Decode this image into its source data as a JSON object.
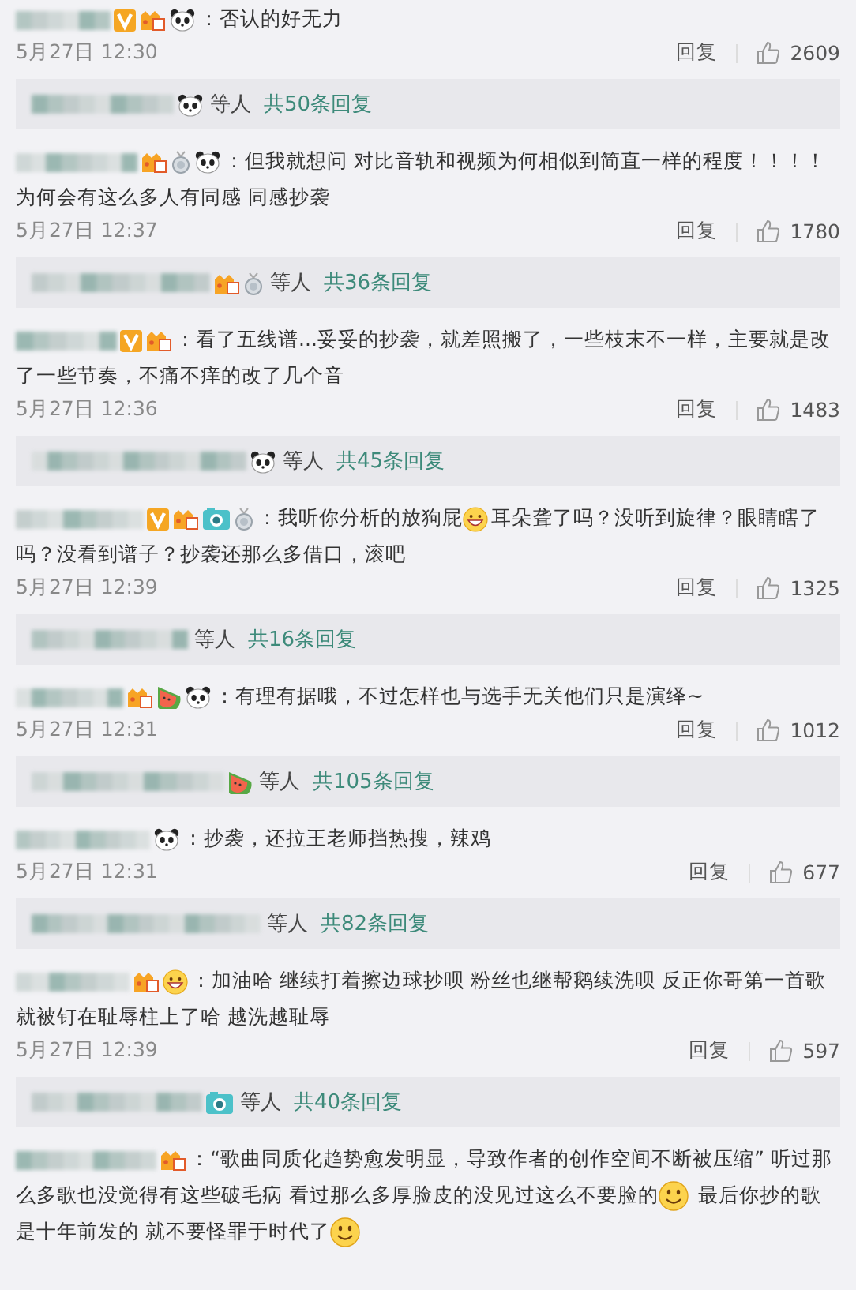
{
  "comments": [
    {
      "badges": [
        {
          "kind": "vip"
        },
        {
          "kind": "level"
        },
        {
          "kind": "panda"
        }
      ],
      "body": [
        {
          "kind": "text",
          "text": "：否认的好无力"
        }
      ],
      "date": "5月27日 12:30",
      "reply_label": "回复",
      "likes": "2609",
      "replies": {
        "badges": [
          {
            "kind": "panda"
          }
        ],
        "suffix": "等人",
        "count": "共50条回复"
      }
    },
    {
      "badges": [
        {
          "kind": "level"
        },
        {
          "kind": "medal"
        },
        {
          "kind": "panda"
        }
      ],
      "body": [
        {
          "kind": "text",
          "text": "：但我就想问 对比音轨和视频为何相似到简直一样的程度！！！！为何会有这么多人有同感 同感抄袭"
        }
      ],
      "date": "5月27日 12:37",
      "reply_label": "回复",
      "likes": "1780",
      "replies": {
        "badges": [
          {
            "kind": "level"
          },
          {
            "kind": "medal"
          }
        ],
        "suffix": "等人",
        "count": "共36条回复"
      }
    },
    {
      "badges": [
        {
          "kind": "vip"
        },
        {
          "kind": "level"
        }
      ],
      "body": [
        {
          "kind": "text",
          "text": "：看了五线谱...妥妥的抄袭，就差照搬了，一些枝末不一样，主要就是改了一些节奏，不痛不痒的改了几个音"
        }
      ],
      "date": "5月27日 12:36",
      "reply_label": "回复",
      "likes": "1483",
      "replies": {
        "badges": [
          {
            "kind": "panda"
          }
        ],
        "suffix": "等人",
        "count": "共45条回复"
      }
    },
    {
      "badges": [
        {
          "kind": "vip"
        },
        {
          "kind": "level"
        },
        {
          "kind": "camera"
        },
        {
          "kind": "medal"
        }
      ],
      "body": [
        {
          "kind": "text",
          "text": "：我听你分析的放狗屁"
        },
        {
          "kind": "grin"
        },
        {
          "kind": "text",
          "text": "耳朵聋了吗？没听到旋律？眼睛瞎了吗？没看到谱子？抄袭还那么多借口，滚吧"
        }
      ],
      "date": "5月27日 12:39",
      "reply_label": "回复",
      "likes": "1325",
      "replies": {
        "suffix": "等人",
        "count": "共16条回复"
      }
    },
    {
      "badges": [
        {
          "kind": "level"
        },
        {
          "kind": "watermelon"
        },
        {
          "kind": "panda"
        }
      ],
      "body": [
        {
          "kind": "text",
          "text": "：有理有据哦，不过怎样也与选手无关他们只是演绎~"
        }
      ],
      "date": "5月27日 12:31",
      "reply_label": "回复",
      "likes": "1012",
      "replies": {
        "badges": [
          {
            "kind": "watermelon"
          }
        ],
        "suffix": "等人",
        "count": "共105条回复"
      }
    },
    {
      "badges": [
        {
          "kind": "panda"
        }
      ],
      "body": [
        {
          "kind": "text",
          "text": "：抄袭，还拉王老师挡热搜，辣鸡"
        }
      ],
      "date": "5月27日 12:31",
      "reply_label": "回复",
      "likes": "677",
      "replies": {
        "suffix": "等人",
        "count": "共82条回复"
      }
    },
    {
      "badges": [
        {
          "kind": "level"
        },
        {
          "kind": "grin"
        }
      ],
      "body": [
        {
          "kind": "text",
          "text": "：加油哈 继续打着擦边球抄呗 粉丝也继帮鹅续洗呗 反正你哥第一首歌就被钉在耻辱柱上了哈 越洗越耻辱"
        }
      ],
      "date": "5月27日 12:39",
      "reply_label": "回复",
      "likes": "597",
      "replies": {
        "badges": [
          {
            "kind": "camera"
          }
        ],
        "suffix": "等人",
        "count": "共40条回复"
      }
    },
    {
      "badges": [
        {
          "kind": "level"
        }
      ],
      "body": [
        {
          "kind": "text",
          "text": "：“歌曲同质化趋势愈发明显，导致作者的创作空间不断被压缩” 听过那么多歌也没觉得有这些破毛病 看过那么多厚脸皮的没见过这么不要脸的"
        },
        {
          "kind": "smile"
        },
        {
          "kind": "text",
          "text": " 最后你抄的歌是十年前发的 就不要怪罪于时代了"
        },
        {
          "kind": "smile"
        }
      ]
    }
  ]
}
